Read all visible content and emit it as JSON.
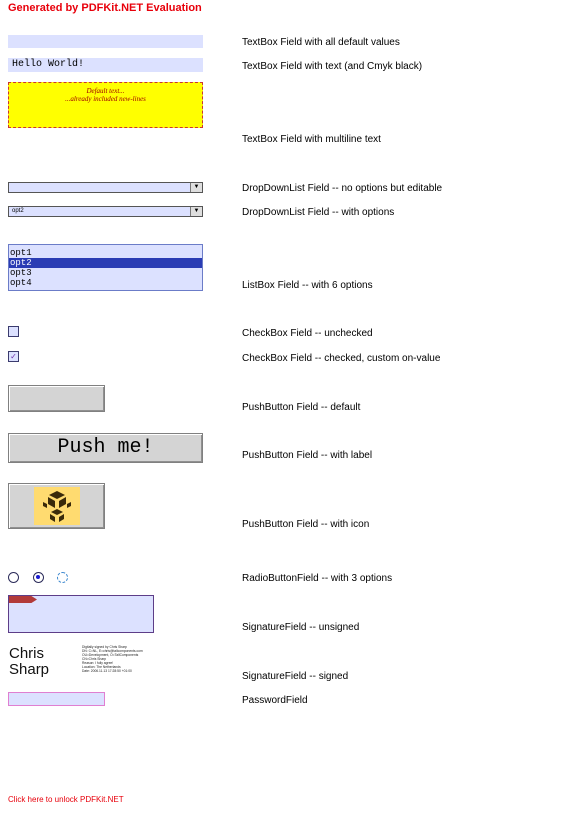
{
  "header": {
    "title": "Generated by PDFKit.NET Evaluation"
  },
  "footer": {
    "unlock_link": "Click here to unlock PDFKit.NET"
  },
  "fields": {
    "textbox_default": {
      "label": "TextBox Field with all default values",
      "value": ""
    },
    "textbox_text": {
      "label": "TextBox Field with text (and Cmyk black)",
      "value": "Hello World!"
    },
    "textbox_multiline": {
      "label": "TextBox Field with multiline text",
      "line1": "Default text...",
      "line2": "...already included new-lines"
    },
    "dropdown_editable": {
      "label": "DropDownList Field -- no options but editable",
      "value": ""
    },
    "dropdown_options": {
      "label": "DropDownList Field -- with options",
      "value": "opt2"
    },
    "listbox": {
      "label": "ListBox Field -- with 6 options",
      "items": [
        "opt1",
        "opt2",
        "opt3",
        "opt4"
      ],
      "selected": "opt2"
    },
    "checkbox_unchecked": {
      "label": "CheckBox Field -- unchecked"
    },
    "checkbox_checked": {
      "label": "CheckBox Field -- checked, custom on-value",
      "mark": "✓"
    },
    "pushbutton_default": {
      "label": "PushButton Field -- default"
    },
    "pushbutton_label": {
      "label": "PushButton Field -- with label",
      "button_text": "Push me!"
    },
    "pushbutton_icon": {
      "label": "PushButton Field -- with icon",
      "icon": "tall-components-logo-icon"
    },
    "radio": {
      "label": "RadioButtonField -- with 3 options"
    },
    "signature_unsigned": {
      "label": "SignatureField -- unsigned"
    },
    "signature_signed": {
      "label": "SignatureField -- signed",
      "name_line1": "Chris",
      "name_line2": "Sharp",
      "details": [
        "Digitally signed by Chris Sharp",
        "DN: C=NL, E=chris@tallcomponents.com",
        "OU=Development, O=TallComponents",
        "CN=Chris Sharp",
        "Reason: I fully agree!",
        "Location: The Netherlands",
        "Date: 2006.11.13 17:28:50 +01:00"
      ]
    },
    "password": {
      "label": "PasswordField"
    }
  },
  "colors": {
    "accent_red": "#e8000b",
    "field_background": "#dce1ff",
    "multiline_background": "#ffff00",
    "listbox_selection": "#2a3cb4"
  }
}
